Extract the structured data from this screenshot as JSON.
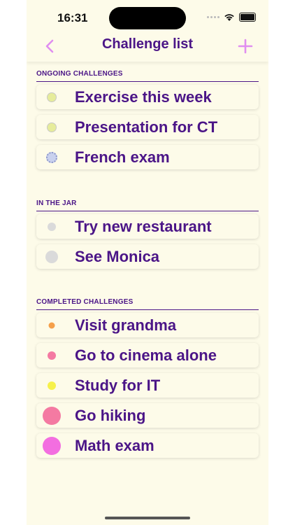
{
  "status_bar": {
    "time": "16:31"
  },
  "nav": {
    "title": "Challenge list",
    "back_icon": "chevron-left-icon",
    "add_icon": "plus-icon",
    "accent": "#e08ef0"
  },
  "sections": [
    {
      "header": "ONGOING CHALLENGES",
      "items": [
        {
          "label": "Exercise this week",
          "dot_color": "#e6ec9a",
          "dot_style": "small-ringed"
        },
        {
          "label": "Presentation for CT",
          "dot_color": "#e6ec9a",
          "dot_style": "small-ringed"
        },
        {
          "label": "French exam",
          "dot_color": "#c9d1ee",
          "dot_style": "dashed-ring"
        }
      ]
    },
    {
      "header": "IN THE JAR",
      "items": [
        {
          "label": "Try new restaurant",
          "dot_color": "#dadada",
          "dot_style": "small"
        },
        {
          "label": "See Monica",
          "dot_color": "#dadada",
          "dot_style": "medium"
        }
      ]
    },
    {
      "header": "COMPLETED CHALLENGES",
      "items": [
        {
          "label": "Visit grandma",
          "dot_color": "#f5a04a",
          "dot_style": "tiny"
        },
        {
          "label": "Go to cinema alone",
          "dot_color": "#f47aa2",
          "dot_style": "small"
        },
        {
          "label": "Study for IT",
          "dot_color": "#f6f14a",
          "dot_style": "small"
        },
        {
          "label": "Go hiking",
          "dot_color": "#f47aa2",
          "dot_style": "large"
        },
        {
          "label": "Math exam",
          "dot_color": "#f36ee0",
          "dot_style": "large"
        }
      ]
    }
  ]
}
